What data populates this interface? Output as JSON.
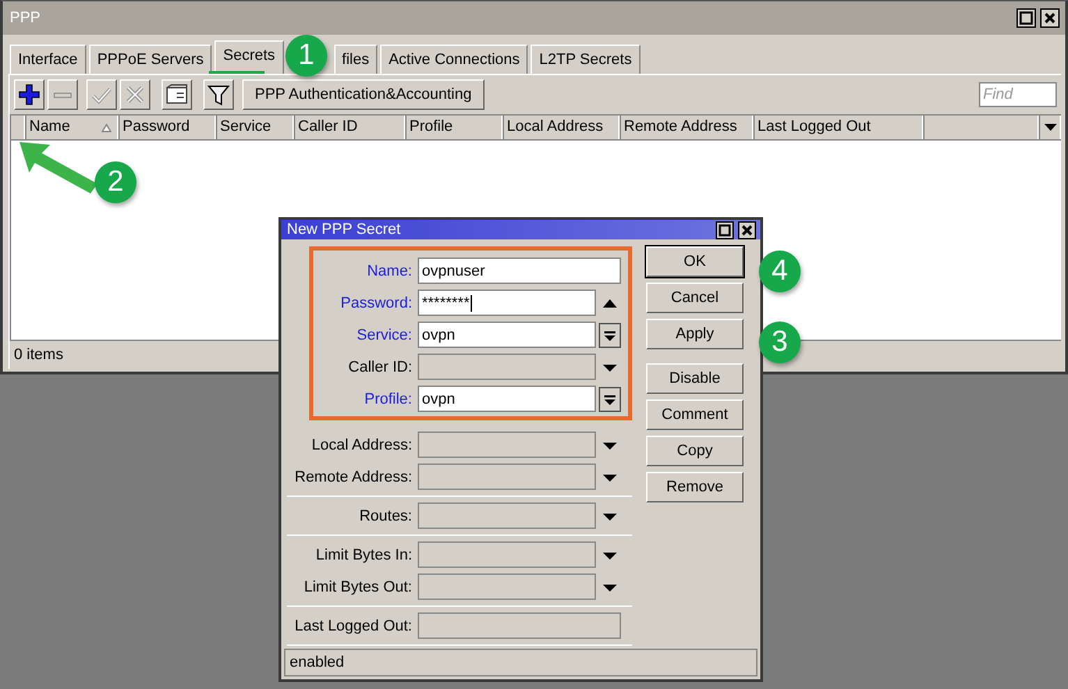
{
  "window": {
    "title": "PPP"
  },
  "tabs": [
    {
      "label": "Interface",
      "selected": false
    },
    {
      "label": "PPPoE Servers",
      "selected": false
    },
    {
      "label": "Secrets",
      "selected": true
    },
    {
      "label": "files",
      "selected": false
    },
    {
      "label": "Active Connections",
      "selected": false
    },
    {
      "label": "L2TP Secrets",
      "selected": false
    }
  ],
  "toolbar": {
    "icons": [
      {
        "kind": "add",
        "disabled": false
      },
      {
        "kind": "remove",
        "disabled": true
      },
      {
        "kind": "enable",
        "disabled": true
      },
      {
        "kind": "disable",
        "disabled": true
      },
      {
        "kind": "comment",
        "disabled": false
      },
      {
        "kind": "filter",
        "disabled": false
      }
    ],
    "button": "PPP Authentication&Accounting",
    "find": {
      "placeholder": "Find"
    }
  },
  "table": {
    "columns": [
      {
        "label": "Name",
        "sorted": true
      },
      {
        "label": "Password",
        "sorted": false
      },
      {
        "label": "Service",
        "sorted": false
      },
      {
        "label": "Caller ID",
        "sorted": false
      },
      {
        "label": "Profile",
        "sorted": false
      },
      {
        "label": "Local Address",
        "sorted": false
      },
      {
        "label": "Remote Address",
        "sorted": false
      },
      {
        "label": "Last Logged Out",
        "sorted": false
      }
    ],
    "status": "0 items"
  },
  "dialog": {
    "title": "New PPP Secret",
    "groups": [
      {
        "highlighted": true,
        "fields": [
          {
            "label": "Name:",
            "kind": "text",
            "required": true,
            "value": "ovpnuser"
          },
          {
            "label": "Password:",
            "kind": "password",
            "required": true,
            "value": "********"
          },
          {
            "label": "Service:",
            "kind": "combo",
            "required": true,
            "value": "ovpn"
          },
          {
            "label": "Caller ID:",
            "kind": "dropdown",
            "required": false
          },
          {
            "label": "Profile:",
            "kind": "combo",
            "required": true,
            "value": "ovpn"
          }
        ]
      },
      {
        "highlighted": false,
        "fields": [
          {
            "label": "Local Address:",
            "kind": "dropdown",
            "required": false
          },
          {
            "label": "Remote Address:",
            "kind": "dropdown",
            "required": false
          }
        ]
      },
      {
        "highlighted": false,
        "fields": [
          {
            "label": "Routes:",
            "kind": "dropdown",
            "required": false
          }
        ]
      },
      {
        "highlighted": false,
        "fields": [
          {
            "label": "Limit Bytes In:",
            "kind": "dropdown",
            "required": false
          },
          {
            "label": "Limit Bytes Out:",
            "kind": "dropdown",
            "required": false
          }
        ]
      },
      {
        "highlighted": false,
        "fields": [
          {
            "label": "Last Logged Out:",
            "kind": "readonly",
            "required": false
          }
        ]
      }
    ],
    "buttons": [
      {
        "label": "OK",
        "default": true
      },
      {
        "label": "Cancel",
        "default": false
      },
      {
        "label": "Apply",
        "default": false
      },
      {
        "label": "Disable",
        "default": false
      },
      {
        "label": "Comment",
        "default": false
      },
      {
        "label": "Copy",
        "default": false
      },
      {
        "label": "Remove",
        "default": false
      }
    ],
    "status": "enabled"
  },
  "annotations": [
    {
      "label": "1"
    },
    {
      "label": "2"
    },
    {
      "label": "3"
    },
    {
      "label": "4"
    }
  ]
}
